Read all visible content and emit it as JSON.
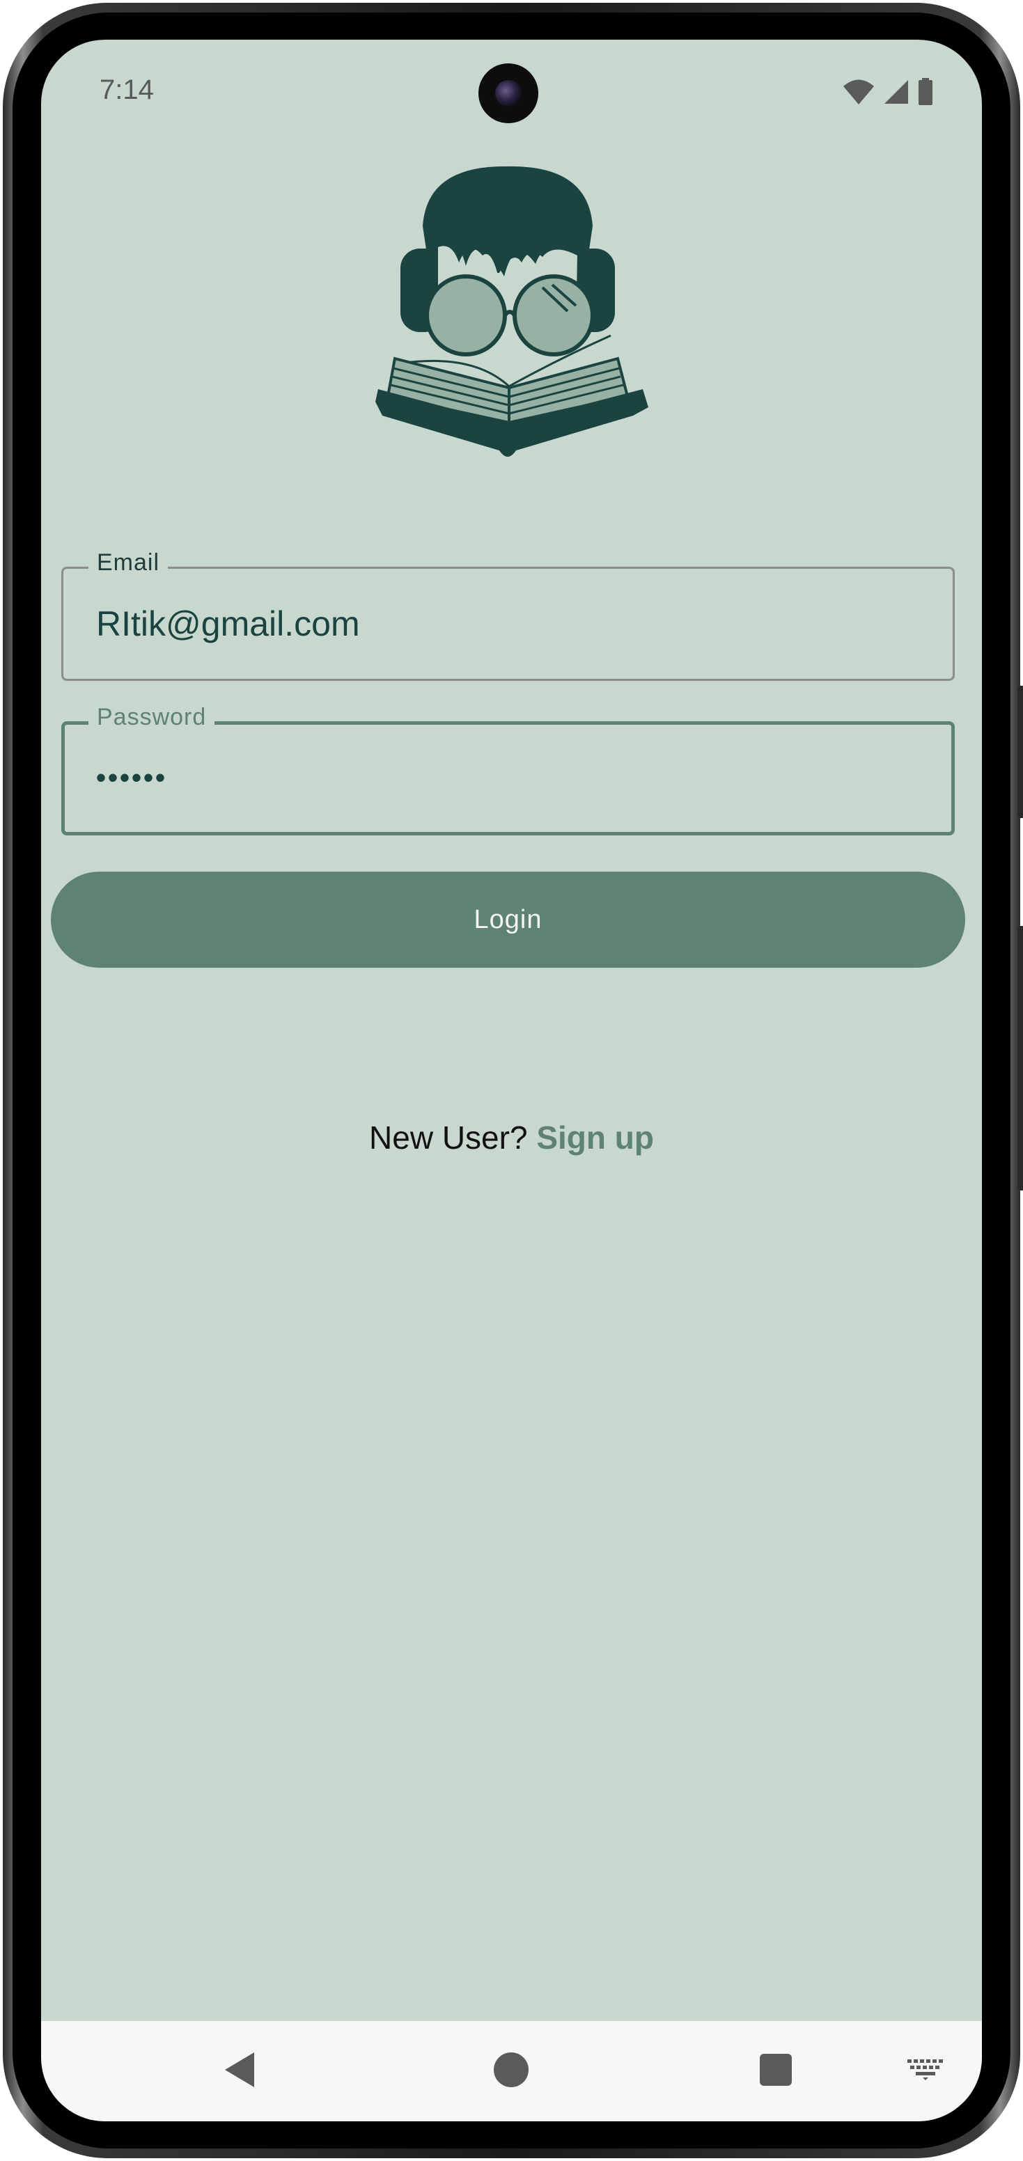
{
  "status_bar": {
    "time": "7:14",
    "icons": [
      "wifi-icon",
      "cellular-signal-icon",
      "battery-icon"
    ]
  },
  "logo": {
    "icon": "reader-with-book-logo"
  },
  "login_form": {
    "email": {
      "label": "Email",
      "value": "RItik@gmail.com"
    },
    "password": {
      "label": "Password",
      "value": "••••••"
    },
    "login_button": "Login"
  },
  "signup": {
    "prompt": "New User?",
    "link": "Sign up"
  },
  "navigation_bar": {
    "buttons": [
      "back-icon",
      "home-icon",
      "recents-icon",
      "keyboard-icon"
    ]
  },
  "colors": {
    "background": "#c8d8ce",
    "primary": "#5e8370",
    "dark_teal": "#1b4440",
    "nav_bar": "#f7f7f7"
  }
}
